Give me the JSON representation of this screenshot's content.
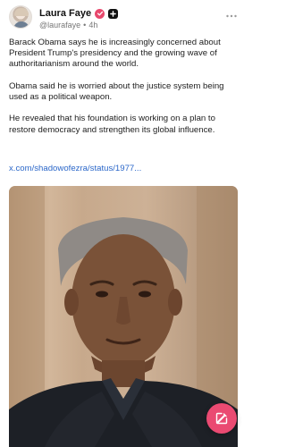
{
  "post": {
    "author": {
      "name": "Laura Faye",
      "handle": "@laurafaye",
      "separator": "•",
      "time": "4h"
    },
    "paragraphs": [
      "Barack Obama says he is increasingly concerned about President Trump's presidency and the growing wave of authoritarianism around the world.",
      "Obama said he is worried about the justice system being used as a political weapon.",
      "He revealed that his foundation is working on a plan to restore democracy and strengthen its global influence."
    ],
    "link_text": "x.com/shadowofezra/status/1977...",
    "image_alt": "Barack Obama portrait"
  },
  "icons": {
    "verified": "verified-badge-icon",
    "follow": "plus-icon",
    "more": "more-horizontal-icon",
    "compose": "compose-edit-icon"
  },
  "colors": {
    "accent": "#e8486d",
    "link": "#2b67c9",
    "fab": "#ea4a72"
  }
}
